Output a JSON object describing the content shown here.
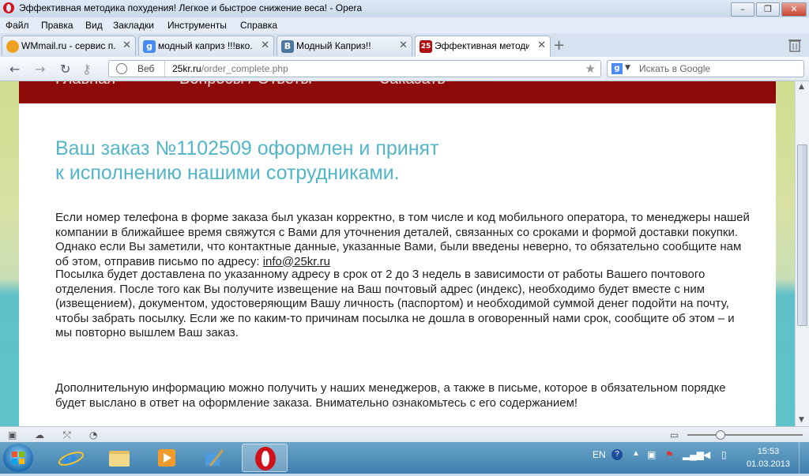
{
  "window": {
    "title": "Эффективная методика похудения! Легкое и быстрое снижение веса! - Opera"
  },
  "menu": [
    "Файл",
    "Правка",
    "Вид",
    "Закладки",
    "Инструменты",
    "Справка"
  ],
  "tabs": [
    {
      "label": "WMmail.ru - сервис п...",
      "color": "#f0a020"
    },
    {
      "label": "модный каприз !!!вко...",
      "color": "#4a8af4"
    },
    {
      "label": "Модный Каприз!!",
      "color": "#4d76a1"
    },
    {
      "label": "Эффективная методик...",
      "color": "#b01010",
      "favtext": "25",
      "active": true
    }
  ],
  "address": {
    "site_label": "Веб",
    "domain": "25kr.ru",
    "path": "/order_complete.php"
  },
  "search": {
    "placeholder": "Искать в Google",
    "engine_icon": "g"
  },
  "site": {
    "nav": [
      "Главная",
      "Вопросы / Ответы",
      "Заказать"
    ],
    "heading_line1": "Ваш заказ №1102509 оформлен и принят",
    "heading_line2": "к исполнению нашими сотрудниками.",
    "para1_text": "Если номер телефона в форме заказа был указан корректно, в том числе и код мобильного оператора, то менеджеры нашей компании в ближайшее время свяжутся с Вами для уточнения деталей, связанных со сроками и формой доставки покупки. Однако если Вы заметили, что контактные данные, указанные Вами, были введены неверно, то обязательно сообщите нам об этом, отправив письмо по адресу: ",
    "para1_email": "info@25kr.ru",
    "para2": "Посылка будет доставлена по указанному адресу в срок от 2 до 3 недель в зависимости от работы Вашего почтового отделения. После того как Вы получите извещение на Ваш почтовый адрес (индекс), необходимо будет вместе с ним (извещением), документом, удостоверяющим Вашу личность (паспортом) и необходимой суммой денег подойти на почту, чтобы забрать посылку. Если же по каким-то причинам посылка не дошла в оговоренный нами срок, сообщите об этом – и мы повторно вышлем Ваш заказ.",
    "para3": "Дополнительную информацию можно получить у наших менеджеров, а также в письме, которое в обязательном порядке будет выслано в ответ на оформление заказа. Внимательно ознакомьтесь с его содержанием!"
  },
  "taskbar": {
    "lang": "EN",
    "time": "15:53",
    "date": "01.03.2013"
  },
  "colors": {
    "nav_bg": "#8d0a08",
    "heading": "#52b6c7",
    "opera_red": "#d2121b"
  }
}
